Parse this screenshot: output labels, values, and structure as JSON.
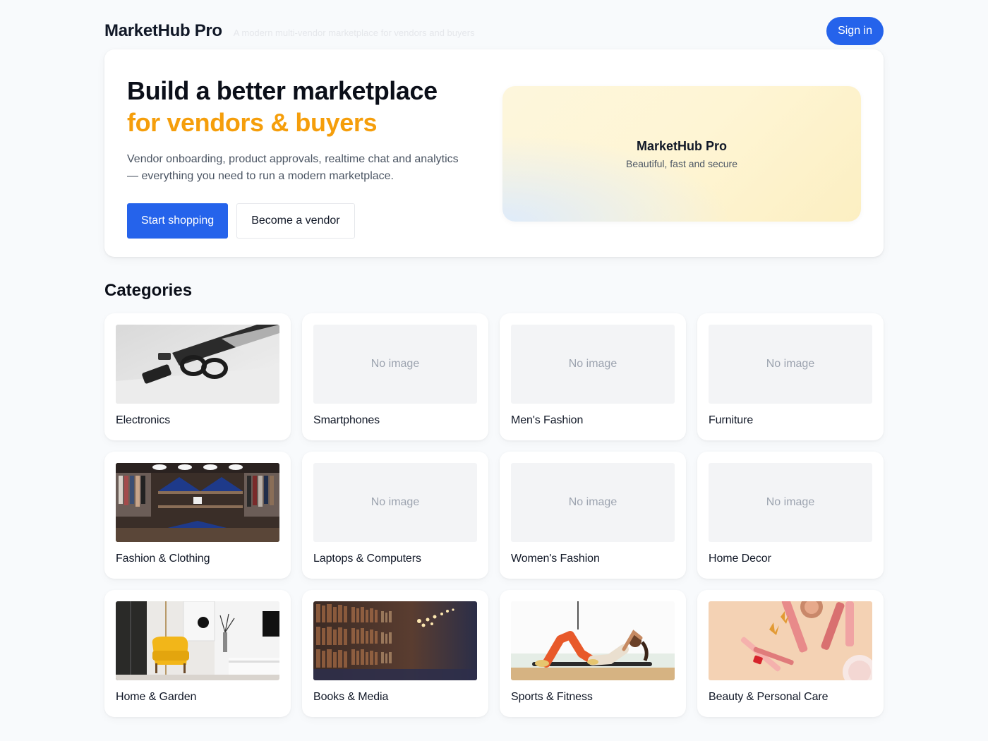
{
  "header": {
    "logo": "MarketHub Pro",
    "tagline": "A modern multi-vendor marketplace for vendors and buyers",
    "signin_label": "Sign in"
  },
  "hero": {
    "title_line1": "Build a better marketplace",
    "title_line2": "for vendors & buyers",
    "description": "Vendor onboarding, product approvals, realtime chat and analytics — everything you need to run a modern marketplace.",
    "primary_cta": "Start shopping",
    "secondary_cta": "Become a vendor",
    "art_title": "MarketHub Pro",
    "art_subtitle": "Beautiful, fast and secure"
  },
  "categories": {
    "title": "Categories",
    "no_image_text": "No image",
    "items": [
      {
        "label": "Electronics",
        "image": "electronics-photo"
      },
      {
        "label": "Smartphones",
        "image": null
      },
      {
        "label": "Men's Fashion",
        "image": null
      },
      {
        "label": "Furniture",
        "image": null
      },
      {
        "label": "Fashion & Clothing",
        "image": "clothing-store-photo"
      },
      {
        "label": "Laptops & Computers",
        "image": null
      },
      {
        "label": "Women's Fashion",
        "image": null
      },
      {
        "label": "Home Decor",
        "image": null
      },
      {
        "label": "Home & Garden",
        "image": "yellow-armchair-photo"
      },
      {
        "label": "Books & Media",
        "image": "library-shelves-photo"
      },
      {
        "label": "Sports & Fitness",
        "image": "woman-exercising-photo"
      },
      {
        "label": "Beauty & Personal Care",
        "image": "makeup-products-photo"
      }
    ]
  },
  "colors": {
    "primary": "#2563eb",
    "accent": "#f59e0b",
    "background": "#f8fafc"
  }
}
